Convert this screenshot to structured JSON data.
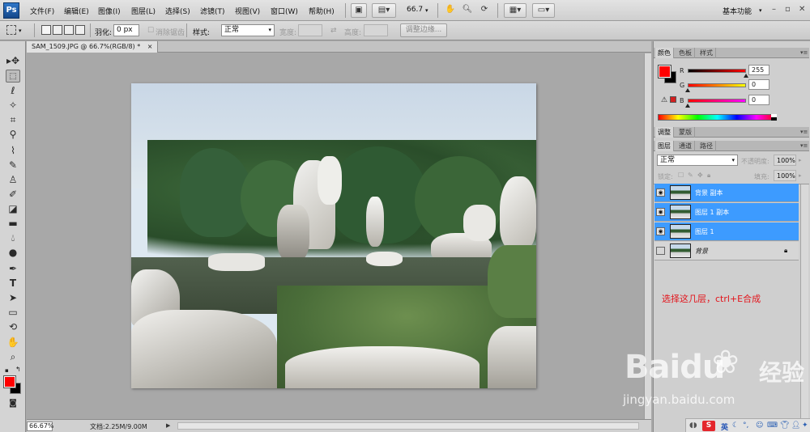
{
  "app": {
    "logo": "Ps",
    "menu": [
      "文件(F)",
      "编辑(E)",
      "图像(I)",
      "图层(L)",
      "选择(S)",
      "滤镜(T)",
      "视图(V)",
      "窗口(W)",
      "帮助(H)"
    ],
    "zoom_dropdown": "66.7",
    "workspace": "基本功能"
  },
  "options": {
    "feather_label": "羽化:",
    "feather_value": "0 px",
    "antialias_label": "消除锯齿",
    "style_label": "样式:",
    "style_value": "正常",
    "width_label": "宽度:",
    "height_label": "高度:",
    "refine_edge_button": "调整边缘..."
  },
  "document": {
    "tab_title": "SAM_1509.JPG @ 66.7%(RGB/8) *",
    "close_symbol": "×"
  },
  "status": {
    "zoom": "66.67%",
    "doc_size": "文档:2.25M/9.00M"
  },
  "color_panel": {
    "tabs": [
      "颜色",
      "色板",
      "样式"
    ],
    "r_label": "R",
    "g_label": "G",
    "b_label": "B",
    "r_value": "255",
    "g_value": "0",
    "b_value": "0",
    "r_level": 1.0,
    "g_level": 0.0,
    "b_level": 0.0,
    "foreground_color": "#ff0000",
    "background_color": "#000000"
  },
  "adjust_panel": {
    "tabs": [
      "调整",
      "蒙版"
    ]
  },
  "layers_panel": {
    "tabs": [
      "图层",
      "通道",
      "路径"
    ],
    "blend_mode": "正常",
    "opacity_label": "不透明度:",
    "opacity_value": "100%",
    "lock_label": "锁定:",
    "fill_label": "填充:",
    "fill_value": "100%",
    "layers": [
      {
        "name": "背景 副本",
        "selected": true,
        "visible": true
      },
      {
        "name": "图层 1 副本",
        "selected": true,
        "visible": true
      },
      {
        "name": "图层 1",
        "selected": true,
        "visible": true
      },
      {
        "name": "背景",
        "selected": false,
        "visible": false,
        "locked": true
      }
    ]
  },
  "annotation": "选择这几层，ctrl+E合成",
  "watermark": {
    "brand": "Baidu",
    "sub": "经验",
    "url": "jingyan.baidu.com"
  },
  "tray": {
    "ime_logo": "S",
    "ime_label": "英"
  },
  "icons": {
    "window_controls": [
      "minimize-icon",
      "restore-icon",
      "close-icon"
    ]
  }
}
